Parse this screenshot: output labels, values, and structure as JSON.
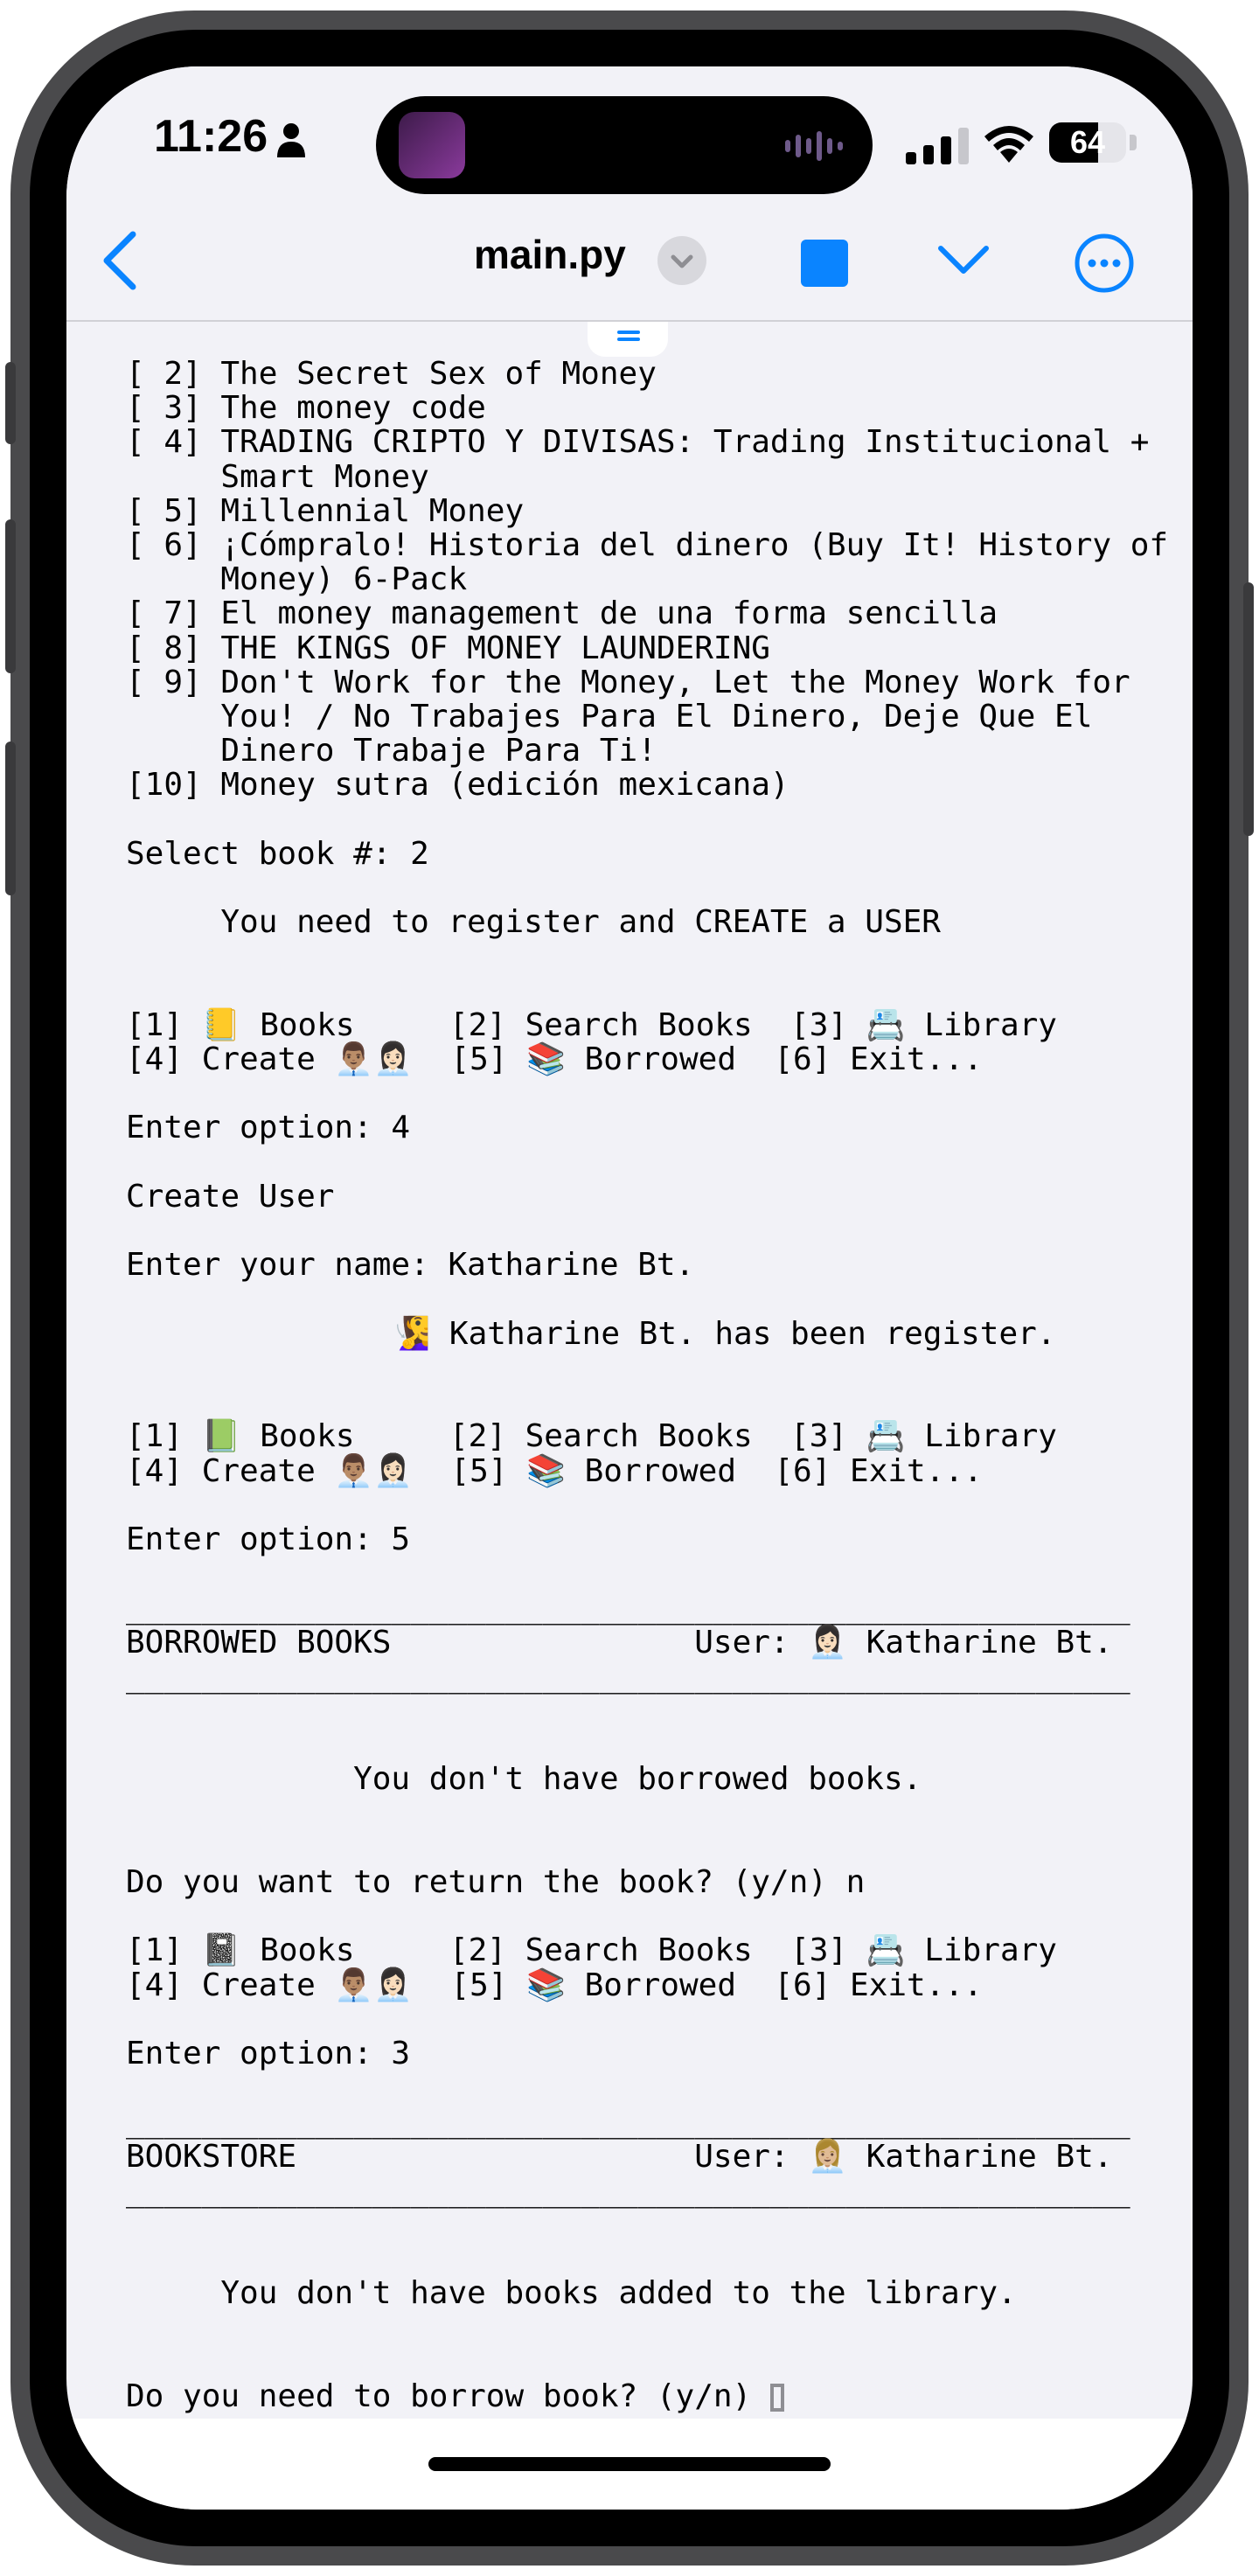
{
  "status_bar": {
    "time": "11:26",
    "battery": "64",
    "battery_level_percent": 64,
    "icons": [
      "person-icon",
      "signal-icon",
      "wifi-icon",
      "battery-icon"
    ]
  },
  "nav": {
    "title": "main.py",
    "icons": [
      "chevron-left-icon",
      "chevron-down-icon",
      "stop-icon",
      "more-icon"
    ],
    "accent_color": "#0a84ff"
  },
  "terminal": {
    "lines": [
      "[ 2] The Secret Sex of Money",
      "[ 3] The money code",
      "[ 4] TRADING CRIPTO Y DIVISAS: Trading Institucional +",
      "     Smart Money",
      "[ 5] Millennial Money",
      "[ 6] ¡Cómpralo! Historia del dinero (Buy It! History of",
      "     Money) 6-Pack",
      "[ 7] El money management de una forma sencilla",
      "[ 8] THE KINGS OF MONEY LAUNDERING",
      "[ 9] Don't Work for the Money, Let the Money Work for",
      "     You! / No Trabajes Para El Dinero, Deje Que El",
      "     Dinero Trabaje Para Ti!",
      "[10] Money sutra (edición mexicana)",
      "",
      "Select book #: 2",
      "",
      "     You need to register and CREATE a USER",
      "",
      "",
      "[1] 📒 Books     [2] Search Books  [3] 📇 Library",
      "[4] Create 👨🏽‍💼👩🏻‍💼  [5] 📚 Borrowed  [6] Exit...",
      "",
      "Enter option: 4",
      "",
      "Create User",
      "",
      "Enter your name: Katharine Bt.",
      "",
      "              🧏‍♀️ Katharine Bt. has been register.",
      "",
      "",
      "[1] 📗 Books     [2] Search Books  [3] 📇 Library",
      "[4] Create 👨🏽‍💼👩🏻‍💼  [5] 📚 Borrowed  [6] Exit...",
      "",
      "Enter option: 5",
      "",
      "_____________________________________________________",
      "BORROWED BOOKS                User: 👩🏻‍💼 Katharine Bt.",
      "_____________________________________________________",
      "",
      "",
      "            You don't have borrowed books.",
      "",
      "",
      "Do you want to return the book? (y/n) n",
      "",
      "[1] 📓 Books     [2] Search Books  [3] 📇 Library",
      "[4] Create 👨🏽‍💼👩🏻‍💼  [5] 📚 Borrowed  [6] Exit...",
      "",
      "Enter option: 3",
      "",
      "_____________________________________________________",
      "BOOKSTORE                     User: 👩🏼‍💼 Katharine Bt.",
      "_____________________________________________________",
      "",
      "",
      "     You don't have books added to the library.",
      "",
      "",
      "Do you need to borrow book? (y/n) "
    ]
  }
}
